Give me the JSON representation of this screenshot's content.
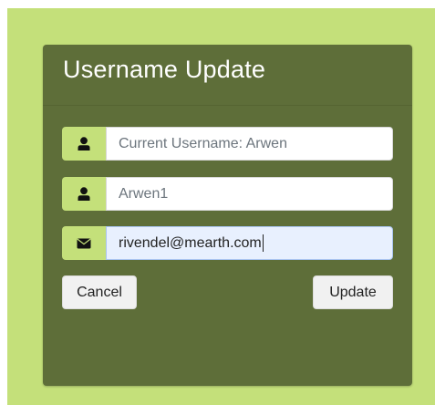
{
  "card": {
    "title": "Username Update"
  },
  "fields": {
    "current_username": {
      "icon": "user-icon",
      "placeholder": "Current Username: Arwen"
    },
    "new_username": {
      "icon": "user-icon",
      "value": "Arwen1"
    },
    "email": {
      "icon": "envelope-icon",
      "value": "rivendel@mearth.com"
    }
  },
  "buttons": {
    "cancel_label": "Cancel",
    "update_label": "Update"
  },
  "colors": {
    "outer_background": "#c4e07a",
    "card_background": "#5e6e39",
    "addon_background": "#c4e07a",
    "focused_field": "#e8f0fe"
  }
}
